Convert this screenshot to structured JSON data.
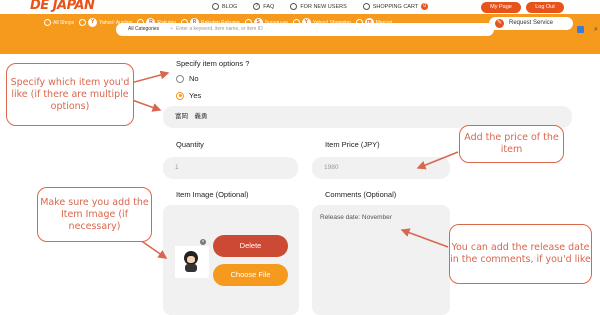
{
  "header": {
    "logo": "DE JAPAN",
    "links": [
      {
        "label": "BLOG",
        "icon": "monitor-icon"
      },
      {
        "label": "FAQ",
        "icon": "question-icon"
      },
      {
        "label": "FOR NEW USERS",
        "icon": "user-icon"
      },
      {
        "label": "SHOPPING CART",
        "icon": "cart-icon",
        "badge": "0"
      }
    ],
    "my_page": "My Page",
    "log_out": "Log Out"
  },
  "shops": [
    {
      "label": "All Shops"
    },
    {
      "label": "Yahoo! Auction"
    },
    {
      "label": "Rakuten"
    },
    {
      "label": "Rakuten Rakuma"
    },
    {
      "label": "Surugu-ya"
    },
    {
      "label": "Yahoo! Shopping"
    },
    {
      "label": "Mercari"
    }
  ],
  "request_service": "Request Service",
  "search": {
    "category": "All Categories",
    "placeholder": "Enter a keyword, item name, or item ID"
  },
  "form": {
    "options_label": "Specify item options ?",
    "option_no": "No",
    "option_yes": "Yes",
    "option_value": "富岡　義勇",
    "quantity_label": "Quantity",
    "quantity_value": "1",
    "price_label": "Item Price (JPY)",
    "price_value": "1980",
    "image_label": "Item Image (Optional)",
    "comments_label": "Comments (Optional)",
    "comments_value": "Release date: November",
    "delete_label": "Delete",
    "choose_file_label": "Choose File"
  },
  "callouts": {
    "options": "Specify which item you'd like (if there are multiple options)",
    "price": "Add the price of the item",
    "image": "Make sure you add the Item Image (if necessary)",
    "comments": "You can add the release date in the comments, if you'd like"
  },
  "colors": {
    "accent": "#f59a1d",
    "brand": "#e8531b",
    "annotation": "#d9674d",
    "delete": "#cc4a33"
  }
}
